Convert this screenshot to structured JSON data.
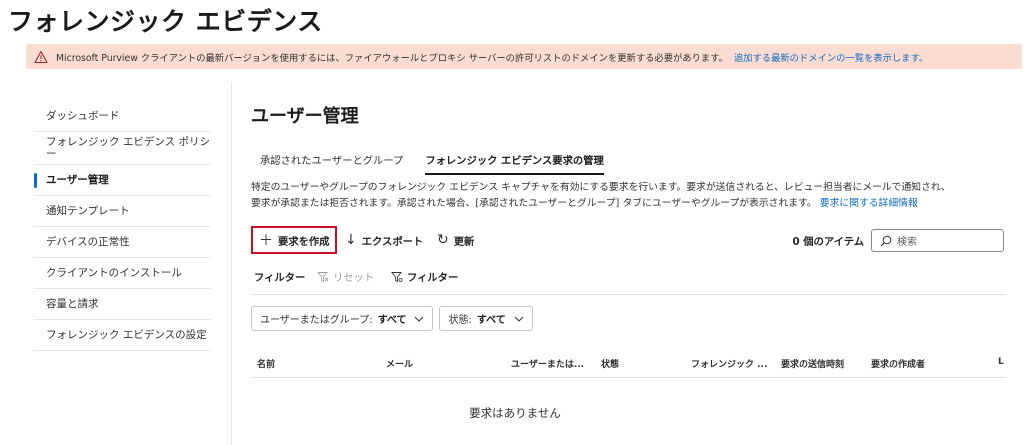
{
  "page": {
    "title": "フォレンジック エビデンス"
  },
  "banner": {
    "message": "Microsoft Purview クライアントの最新バージョンを使用するには、ファイアウォールとプロキシ サーバーの許可リストのドメインを更新する必要があります。",
    "link": "追加する最新のドメインの一覧を表示します。",
    "icon": "warning-icon"
  },
  "sidebar": {
    "items": [
      {
        "label": "ダッシュボード"
      },
      {
        "label": "フォレンジック エビデンス ポリシー"
      },
      {
        "label": "ユーザー管理"
      },
      {
        "label": "通知テンプレート"
      },
      {
        "label": "デバイスの正常性"
      },
      {
        "label": "クライアントのインストール"
      },
      {
        "label": "容量と請求"
      },
      {
        "label": "フォレンジック エビデンスの設定"
      }
    ],
    "active_index": 2
  },
  "main": {
    "title": "ユーザー管理",
    "tabs": [
      {
        "label": "承認されたユーザーとグループ"
      },
      {
        "label": "フォレンジック エビデンス要求の管理"
      }
    ],
    "active_tab": 1,
    "description_line1": "特定のユーザーやグループのフォレンジック エビデンス キャプチャを有効にする要求を行います。要求が送信されると、レビュー担当者にメールで通知され、",
    "description_line2": "要求が承認または拒否されます。承認された場合、[承認されたユーザーとグループ] タブにユーザーやグループが表示されます。",
    "description_link": "要求に関する詳細情報"
  },
  "toolbar": {
    "create_label": "要求を作成",
    "export_label": "エクスポート",
    "refresh_label": "更新",
    "item_count": "0 個のアイテム",
    "search_placeholder": "検索"
  },
  "filters": {
    "label": "フィルター",
    "reset_label": "リセット",
    "filter_label": "フィルター",
    "dropdowns": [
      {
        "label": "ユーザーまたはグループ:",
        "value": "すべて"
      },
      {
        "label": "状態:",
        "value": "すべて"
      }
    ]
  },
  "table": {
    "columns": [
      "名前",
      "メール",
      "ユーザーまたは...",
      "状態",
      "フォレンジック ...",
      "要求の送信時刻",
      "要求の作成者",
      "L"
    ],
    "empty_message": "要求はありません"
  },
  "colors": {
    "accent": "#0f6cbd",
    "banner_bg": "#fbdcd2",
    "highlight_border": "#c50f1f"
  }
}
